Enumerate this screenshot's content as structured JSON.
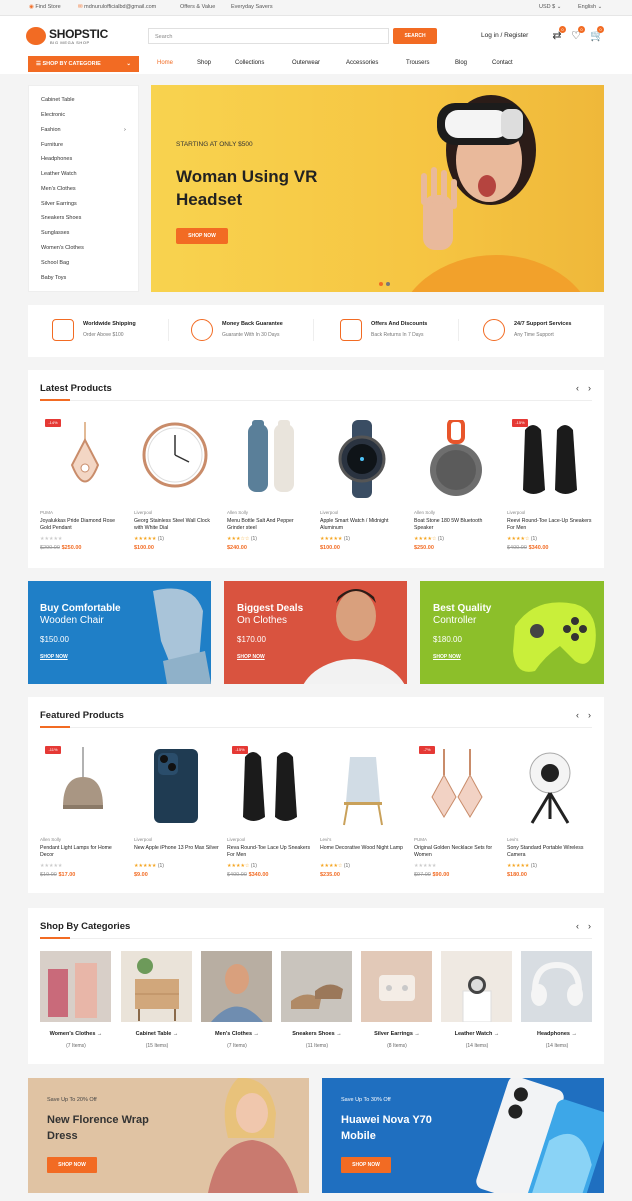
{
  "topbar": {
    "find_store": "Find Store",
    "email": "mdnurulofficialbd@gmail.com",
    "offers": "Offers & Value",
    "savers": "Everyday Savers",
    "currency": "USD $",
    "language": "English"
  },
  "header": {
    "logo": "SHOPSTIC",
    "tagline": "BIG MEGA SHOP",
    "search_placeholder": "Search",
    "search_button": "SEARCH",
    "login": "Log in / Register",
    "badges": [
      "0",
      "0",
      "0"
    ]
  },
  "nav": {
    "category_button": "SHOP BY CATEGORIE",
    "items": [
      "Home",
      "Shop",
      "Collections",
      "Outerwear",
      "Accessories",
      "Trousers",
      "Blog",
      "Contact"
    ]
  },
  "sidebar": [
    "Cabinet Table",
    "Electronic",
    "Fashion",
    "Furniture",
    "Headphones",
    "Leather Watch",
    "Men's Clothes",
    "Silver Earrings",
    "Sneakers Shoes",
    "Sunglasses",
    "Women's Clothes",
    "School Bag",
    "Baby Toys"
  ],
  "hero": {
    "kicker": "STARTING AT ONLY $500",
    "title_line1": "Woman Using VR",
    "title_line2": "Headset",
    "button": "SHOP NOW"
  },
  "services": [
    {
      "title": "Worldwide Shipping",
      "sub": "Order Above $100"
    },
    {
      "title": "Money Back Guarantee",
      "sub": "Guarante With In 30 Days"
    },
    {
      "title": "Offers And Discounts",
      "sub": "Back Returns In 7 Days"
    },
    {
      "title": "24/7 Support Services",
      "sub": "Any Time Support"
    }
  ],
  "latest": {
    "title": "Latest Products",
    "products": [
      {
        "badge": "-14%",
        "brand": "PUMA",
        "name": "Joyalukkas Pride Diamond Rose Gold Pendant",
        "rating": "",
        "old": "$290.00",
        "price": "$250.00"
      },
      {
        "badge": "",
        "brand": "Liverpool",
        "name": "Georg Stainless Steel Wall Clock with White Dial",
        "rating": "(1)",
        "old": "",
        "price": "$100.00"
      },
      {
        "badge": "",
        "brand": "Allen Solly",
        "name": "Menu Bottle Salt And Pepper Grinder steel",
        "rating": "(1)",
        "old": "",
        "price": "$240.00"
      },
      {
        "badge": "",
        "brand": "Liverpool",
        "name": "Apple Smart Watch / Midnight Aluminum",
        "rating": "(1)",
        "old": "",
        "price": "$100.00"
      },
      {
        "badge": "",
        "brand": "Allen Solly",
        "name": "Boat Stone 180 5W Bluetooth Speaker",
        "rating": "(1)",
        "old": "",
        "price": "$250.00"
      },
      {
        "badge": "-15%",
        "brand": "Liverpool",
        "name": "Reevi Round-Toe Lace-Up Sneakers For Men",
        "rating": "(1)",
        "old": "$400.00",
        "price": "$340.00"
      }
    ]
  },
  "promos": [
    {
      "line1": "Buy Comfortable",
      "line2": "Wooden Chair",
      "price": "$150.00",
      "link": "SHOP NOW",
      "color": "#1f7fc7"
    },
    {
      "line1": "Biggest Deals",
      "line2": "On Clothes",
      "price": "$170.00",
      "link": "SHOP NOW",
      "color": "#d9533f"
    },
    {
      "line1": "Best Quality",
      "line2": "Controller",
      "price": "$180.00",
      "link": "SHOP NOW",
      "color": "#8cbf2a"
    }
  ],
  "featured": {
    "title": "Featured Products",
    "products": [
      {
        "badge": "-11%",
        "brand": "Allen Solly",
        "name": "Pendant Light Lamps for Home Decor",
        "rating": "",
        "old": "$19.00",
        "price": "$17.00"
      },
      {
        "badge": "",
        "brand": "Liverpool",
        "name": "New Apple iPhone 13 Pro Max Silver",
        "rating": "(1)",
        "old": "",
        "price": "$9.00"
      },
      {
        "badge": "-15%",
        "brand": "Liverpool",
        "name": "Reva Round-Toe Lace Up Sneakers For Men",
        "rating": "(1)",
        "old": "$400.00",
        "price": "$340.00"
      },
      {
        "badge": "",
        "brand": "Levi's",
        "name": "Home Decorative Wood Night Lamp",
        "rating": "(1)",
        "old": "",
        "price": "$235.00"
      },
      {
        "badge": "-7%",
        "brand": "PUMA",
        "name": "Original Golden Necklace Sets for Women",
        "rating": "",
        "old": "$97.00",
        "price": "$90.00"
      },
      {
        "badge": "",
        "brand": "Levi's",
        "name": "Sony Standard Portable Wireless Camera",
        "rating": "(1)",
        "old": "",
        "price": "$180.00"
      }
    ]
  },
  "categories": {
    "title": "Shop By Categories",
    "items": [
      {
        "name": "Women's Clothes",
        "count": "(7 Items)"
      },
      {
        "name": "Cabinet Table",
        "count": "(15 Items)"
      },
      {
        "name": "Men's Clothes",
        "count": "(7 Items)"
      },
      {
        "name": "Sneakers Shoes",
        "count": "(11 Items)"
      },
      {
        "name": "Silver Earrings",
        "count": "(8 Items)"
      },
      {
        "name": "Leather Watch",
        "count": "(14 Items)"
      },
      {
        "name": "Headphones",
        "count": "(14 Items)"
      }
    ]
  },
  "bottom": [
    {
      "kicker": "Save Up To 20% Off",
      "line1": "New Florence Wrap",
      "line2": "Dress",
      "button": "SHOP NOW"
    },
    {
      "kicker": "Save Up To 30% Off",
      "line1": "Huawei Nova Y70",
      "line2": "Mobile",
      "button": "SHOP NOW"
    }
  ]
}
